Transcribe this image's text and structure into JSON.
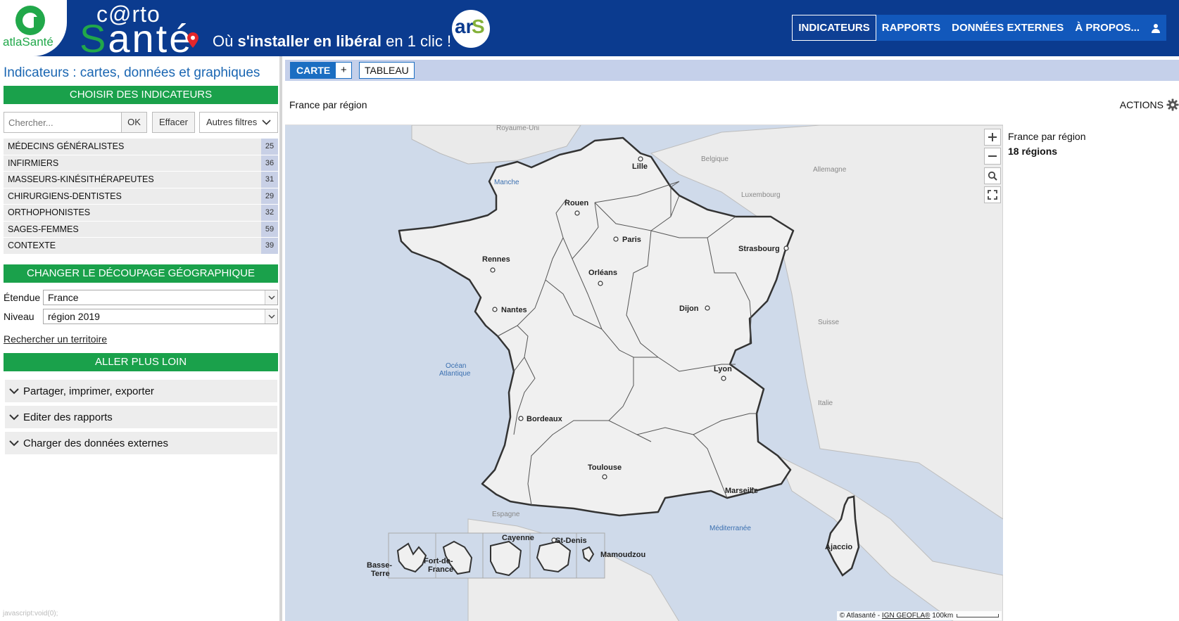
{
  "header": {
    "logo_text": "atlaSanté",
    "carto_sup": "c@rto",
    "carto_main_s": "S",
    "carto_main_rest": "anté",
    "tagline_1": "Où ",
    "tagline_bold": "s'installer en libéral",
    "tagline_2": " en 1 clic !",
    "ars_1": "ar",
    "ars_2": "S",
    "nav": [
      {
        "label": "INDICATEURS",
        "active": true
      },
      {
        "label": "RAPPORTS"
      },
      {
        "label": "DONNÉES EXTERNES"
      },
      {
        "label": "À PROPOS..."
      }
    ],
    "colors": {
      "brand_blue": "#0b3b8f",
      "nav_blue": "#1258bb",
      "brand_green": "#1aa14b"
    }
  },
  "sidebar": {
    "title": "Indicateurs : cartes, données et graphiques",
    "choose_bar": "CHOISIR DES INDICATEURS",
    "search": {
      "placeholder": "Chercher...",
      "ok": "OK",
      "clear": "Effacer",
      "filters": "Autres filtres"
    },
    "indicators": [
      {
        "label": "MÉDECINS GÉNÉRALISTES",
        "count": "25"
      },
      {
        "label": "INFIRMIERS",
        "count": "36"
      },
      {
        "label": "MASSEURS-KINÉSITHÉRAPEUTES",
        "count": "31"
      },
      {
        "label": "CHIRURGIENS-DENTISTES",
        "count": "29"
      },
      {
        "label": "ORTHOPHONISTES",
        "count": "32"
      },
      {
        "label": "SAGES-FEMMES",
        "count": "59"
      },
      {
        "label": "CONTEXTE",
        "count": "39"
      }
    ],
    "geo_bar": "CHANGER LE DÉCOUPAGE GÉOGRAPHIQUE",
    "etendue": {
      "label": "Étendue",
      "value": "France"
    },
    "niveau": {
      "label": "Niveau",
      "value": "région 2019"
    },
    "search_territory": "Rechercher un territoire",
    "further_bar": "ALLER PLUS LOIN",
    "accordions": [
      "Partager, imprimer, exporter",
      "Editer des rapports",
      "Charger des données externes"
    ],
    "status": "javascript:void(0);"
  },
  "main": {
    "tab_carte": "CARTE",
    "tab_plus": "+",
    "tab_tableau": "TABLEAU",
    "map_title": "France par région",
    "actions": "ACTIONS",
    "legend_title": "France par région",
    "legend_count": "18",
    "legend_unit": "régions",
    "attribution_1": "© Atlasanté - ",
    "attribution_link": "IGN GEOFLA®",
    "attribution_scale": "100km",
    "map": {
      "cities": [
        "Lille",
        "Rouen",
        "Paris",
        "Strasbourg",
        "Rennes",
        "Orléans",
        "Nantes",
        "Dijon",
        "Lyon",
        "Bordeaux",
        "Toulouse",
        "Marseille",
        "Ajaccio"
      ],
      "seas": [
        "Manche",
        "Océan",
        "Atlantique",
        "Méditerranée"
      ],
      "neighbors": [
        "Royaume-Uni",
        "Belgique",
        "Allemagne",
        "Luxembourg",
        "Suisse",
        "Italie",
        "Espagne"
      ],
      "overseas": [
        "Basse-",
        "Terre",
        "Fort-de-",
        "France",
        "Cayenne",
        "St-Denis",
        "Mamoudzou"
      ]
    }
  }
}
